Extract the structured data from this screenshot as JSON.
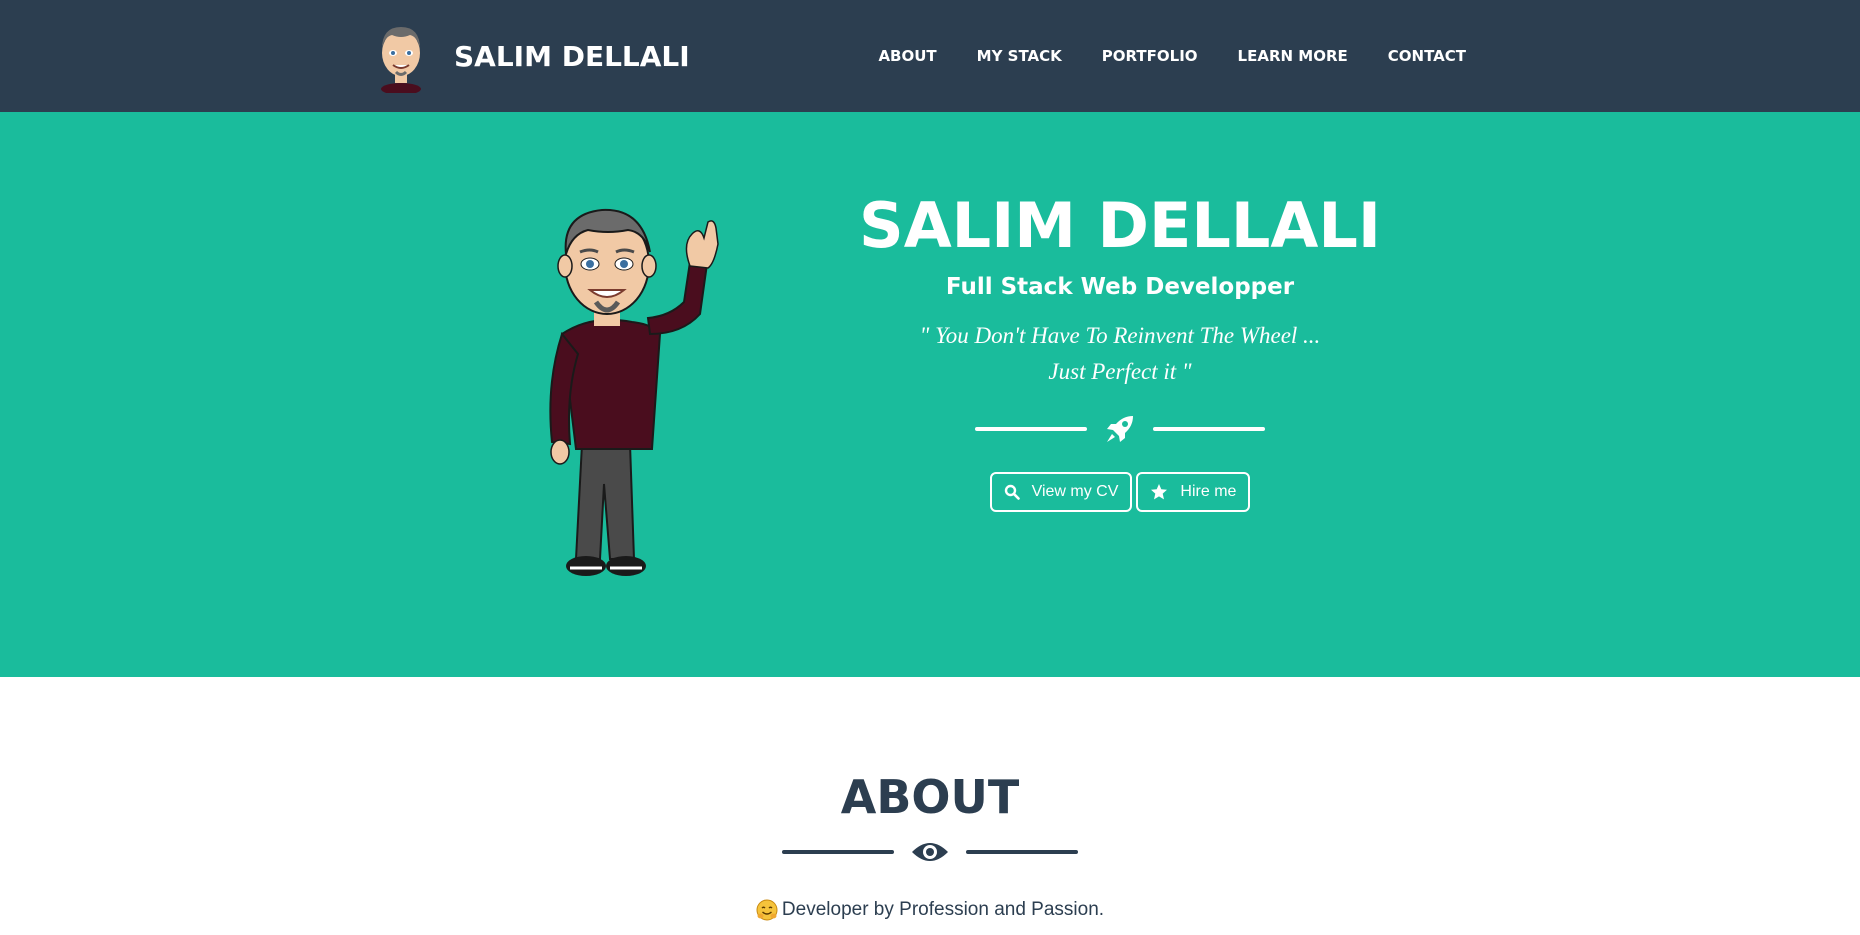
{
  "navbar": {
    "brand_name": "SALIM DELLALI",
    "links": [
      "ABOUT",
      "MY STACK",
      "PORTFOLIO",
      "LEARN MORE",
      "CONTACT"
    ],
    "background": "#2c3e50"
  },
  "hero": {
    "title": "SALIM DELLALI",
    "subtitle": "Full Stack Web Developper",
    "quote_line1": "\" You Don't Have To Reinvent The Wheel ...",
    "quote_line2": "Just Perfect it \"",
    "divider_icon": "rocket-icon",
    "buttons": [
      {
        "label": "View my CV",
        "icon": "search-icon"
      },
      {
        "label": "Hire me",
        "icon": "star-icon"
      }
    ],
    "background": "#1abc9c"
  },
  "about": {
    "title": "ABOUT",
    "divider_icon": "eye-icon",
    "text": "Developer by Profession and Passion.",
    "text_icon": "hugging-face-emoji"
  }
}
